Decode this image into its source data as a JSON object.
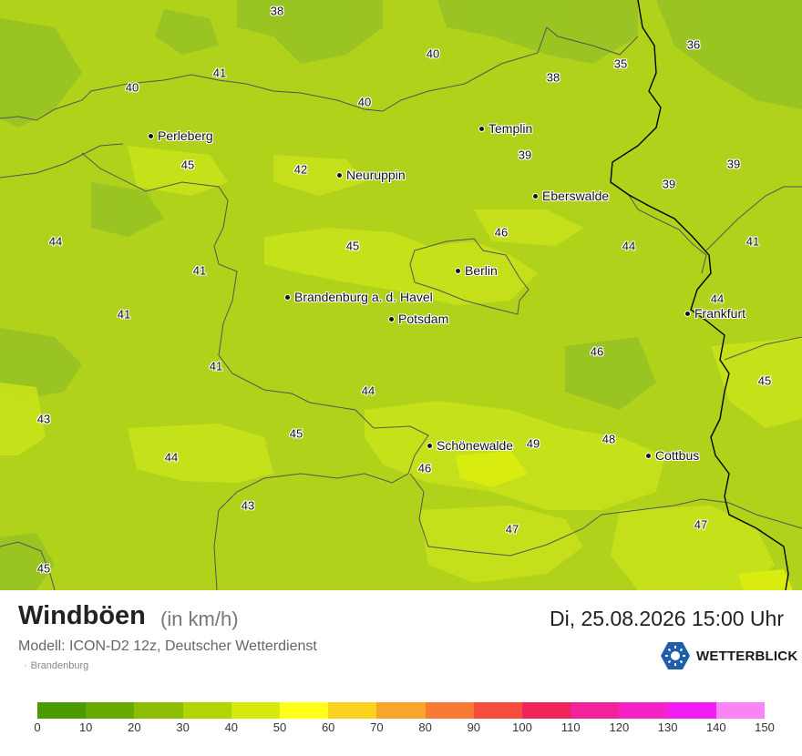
{
  "map": {
    "cities": [
      {
        "name": "Perleberg"
      },
      {
        "name": "Templin"
      },
      {
        "name": "Neuruppin"
      },
      {
        "name": "Eberswalde"
      },
      {
        "name": "Berlin"
      },
      {
        "name": "Brandenburg a. d. Havel"
      },
      {
        "name": "Potsdam"
      },
      {
        "name": "Frankfurt"
      },
      {
        "name": "Schönewalde"
      },
      {
        "name": "Cottbus"
      }
    ],
    "values": [
      "38",
      "40",
      "36",
      "41",
      "40",
      "35",
      "38",
      "40",
      "39",
      "42",
      "39",
      "45",
      "39",
      "46",
      "44",
      "41",
      "45",
      "44",
      "41",
      "44",
      "41",
      "46",
      "41",
      "45",
      "43",
      "44",
      "45",
      "49",
      "48",
      "44",
      "46",
      "43",
      "47",
      "47",
      "45"
    ]
  },
  "legend": {
    "title": "Windböen",
    "unit": "(in km/h)",
    "datetime": "Di, 25.08.2026 15:00 Uhr",
    "model": "Modell: ICON-D2 12z, Deutscher Wetterdienst",
    "region": "Brandenburg",
    "logo": "WETTERBLICK",
    "scale_colors": [
      "#4a9a00",
      "#66aa00",
      "#8cbd00",
      "#b2d400",
      "#d6ea0c",
      "#ffff1a",
      "#fbd31f",
      "#f9a42a",
      "#f87a34",
      "#f54d3c",
      "#f2225a",
      "#f2229a",
      "#f522c8",
      "#f01ef2",
      "#f884f5"
    ],
    "scale_ticks": [
      "0",
      "10",
      "20",
      "30",
      "40",
      "50",
      "60",
      "70",
      "80",
      "90",
      "100",
      "110",
      "120",
      "130",
      "140",
      "150"
    ]
  }
}
